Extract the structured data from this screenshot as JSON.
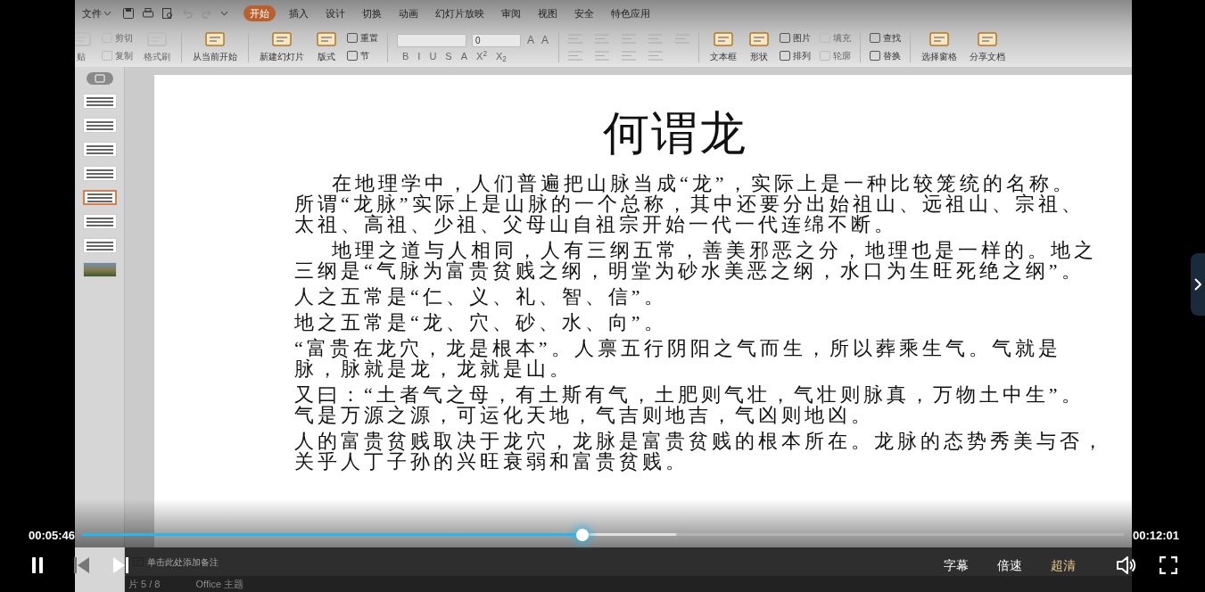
{
  "menu": {
    "file_label": "文件",
    "tabs": [
      {
        "label": "开始",
        "selected": true
      },
      {
        "label": "插入",
        "selected": false
      },
      {
        "label": "设计",
        "selected": false
      },
      {
        "label": "切换",
        "selected": false
      },
      {
        "label": "动画",
        "selected": false
      },
      {
        "label": "幻灯片放映",
        "selected": false
      },
      {
        "label": "审阅",
        "selected": false
      },
      {
        "label": "视图",
        "selected": false
      },
      {
        "label": "安全",
        "selected": false
      },
      {
        "label": "特色应用",
        "selected": false
      }
    ]
  },
  "ribbon": [
    {
      "kind": "large",
      "label": "贴",
      "disabled": true
    },
    {
      "kind": "stack",
      "items": [
        {
          "label": "剪切",
          "disabled": true
        },
        {
          "label": "复制",
          "disabled": true
        }
      ]
    },
    {
      "kind": "large",
      "label": "格式刷",
      "disabled": true
    },
    {
      "kind": "separator"
    },
    {
      "kind": "large",
      "label": "从当前开始",
      "disabled": false
    },
    {
      "kind": "separator"
    },
    {
      "kind": "large",
      "label": "新建幻灯片",
      "disabled": false
    },
    {
      "kind": "large",
      "label": "版式",
      "disabled": false
    },
    {
      "kind": "stack",
      "items": [
        {
          "label": "重置",
          "disabled": false
        },
        {
          "label": "节",
          "disabled": false
        }
      ]
    },
    {
      "kind": "separator"
    },
    {
      "kind": "font",
      "size_value": "0",
      "size_buttons": [
        "A",
        "A"
      ],
      "styles": [
        "B",
        "I",
        "U",
        "S",
        "A",
        "X$^{2}$",
        "X$_{2}$"
      ],
      "disabled": true
    },
    {
      "kind": "separator"
    },
    {
      "kind": "paragraph",
      "disabled": true
    },
    {
      "kind": "separator"
    },
    {
      "kind": "large",
      "label": "文本框",
      "disabled": false
    },
    {
      "kind": "large",
      "label": "形状",
      "disabled": false
    },
    {
      "kind": "stack",
      "items": [
        {
          "label": "图片",
          "disabled": false
        },
        {
          "label": "排列",
          "disabled": false
        }
      ]
    },
    {
      "kind": "stack",
      "items": [
        {
          "label": "填充",
          "disabled": true
        },
        {
          "label": "轮廓",
          "disabled": true
        }
      ]
    },
    {
      "kind": "separator"
    },
    {
      "kind": "stack",
      "items": [
        {
          "label": "查找",
          "disabled": false
        },
        {
          "label": "替换",
          "disabled": false
        }
      ]
    },
    {
      "kind": "separator"
    },
    {
      "kind": "large",
      "label": "选择窗格",
      "disabled": false
    },
    {
      "kind": "large",
      "label": "分享文档",
      "disabled": false
    }
  ],
  "thumbnails": [
    {
      "kind": "text",
      "selected": false
    },
    {
      "kind": "text",
      "selected": false
    },
    {
      "kind": "text",
      "selected": false
    },
    {
      "kind": "text",
      "selected": false
    },
    {
      "kind": "text",
      "selected": true
    },
    {
      "kind": "text",
      "selected": false
    },
    {
      "kind": "text",
      "selected": false
    },
    {
      "kind": "photo",
      "selected": false
    }
  ],
  "slide": {
    "title": "何谓龙",
    "paragraphs": [
      {
        "indent": true,
        "lines": [
          "在地理学中，人们普遍把山脉当成“龙”，实际上是一种比较笼统的名称。",
          "所谓“龙脉”实际上是山脉的一个总称，其中还要分出始祖山、远祖山、宗祖、",
          "太祖、高祖、少祖、父母山自祖宗开始一代一代连绵不断。"
        ]
      },
      {
        "indent": true,
        "lines": [
          "地理之道与人相同，人有三纲五常，善美邪恶之分，地理也是一样的。地之",
          "三纲是“气脉为富贵贫贱之纲，明堂为砂水美恶之纲，水口为生旺死绝之纲”。"
        ]
      },
      {
        "indent": false,
        "lines": [
          "人之五常是“仁、义、礼、智、信”。"
        ]
      },
      {
        "indent": false,
        "lines": [
          "地之五常是“龙、穴、砂、水、向”。"
        ]
      },
      {
        "indent": false,
        "lines": [
          "“富贵在龙穴，龙是根本”。人禀五行阴阳之气而生，所以葬乘生气。气就是",
          "脉，脉就是龙，龙就是山。"
        ]
      },
      {
        "indent": false,
        "lines": [
          "又曰：“土者气之母，有土斯有气，土肥则气壮，气壮则脉真，万物土中生”。",
          "气是万源之源，可运化天地，气吉则地吉，气凶则地凶。"
        ]
      },
      {
        "indent": false,
        "lines": [
          "人的富贵贫贱取决于龙穴，龙脉是富贵贫贱的根本所在。龙脉的态势秀美与否，",
          "关乎人丁子孙的兴旺衰弱和富贵贫贱。"
        ]
      }
    ]
  },
  "notes": {
    "placeholder": "单击此处添加备注"
  },
  "status_bar": {
    "slide_counter": "片 5 / 8",
    "theme": "Office 主题"
  },
  "player": {
    "time_current": "00:05:46",
    "time_total": "00:12:01",
    "progress": {
      "level": 0.48
    },
    "buffer": {
      "level": 0.57
    },
    "playing": true,
    "prev_disabled": true,
    "options": [
      {
        "label": "字幕",
        "selected": false
      },
      {
        "label": "倍速",
        "selected": false
      },
      {
        "label": "超清",
        "selected": true
      }
    ]
  }
}
